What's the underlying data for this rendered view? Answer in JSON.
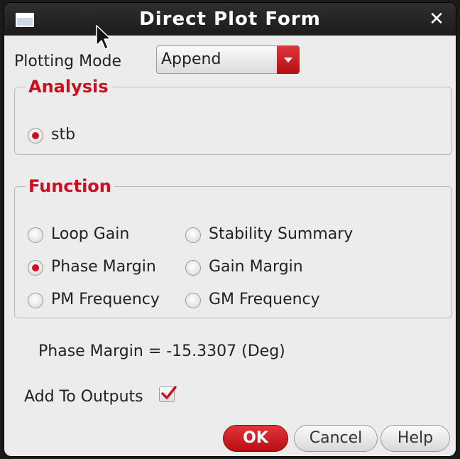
{
  "window": {
    "title": "Direct Plot Form"
  },
  "plotting_mode": {
    "label": "Plotting Mode",
    "value": "Append"
  },
  "analysis": {
    "title": "Analysis",
    "options": [
      {
        "label": "stb",
        "checked": true
      }
    ]
  },
  "function": {
    "title": "Function",
    "options": [
      {
        "label": "Loop Gain",
        "checked": false
      },
      {
        "label": "Stability Summary",
        "checked": false
      },
      {
        "label": "Phase Margin",
        "checked": true
      },
      {
        "label": "Gain Margin",
        "checked": false
      },
      {
        "label": "PM Frequency",
        "checked": false
      },
      {
        "label": "GM Frequency",
        "checked": false
      }
    ]
  },
  "result_text": "Phase Margin = -15.3307 (Deg)",
  "add_to_outputs": {
    "label": "Add To Outputs",
    "checked": true
  },
  "buttons": {
    "ok": "OK",
    "cancel": "Cancel",
    "help": "Help"
  },
  "colors": {
    "accent": "#cc1020",
    "titlebar": "#222222",
    "background": "#ececec"
  }
}
